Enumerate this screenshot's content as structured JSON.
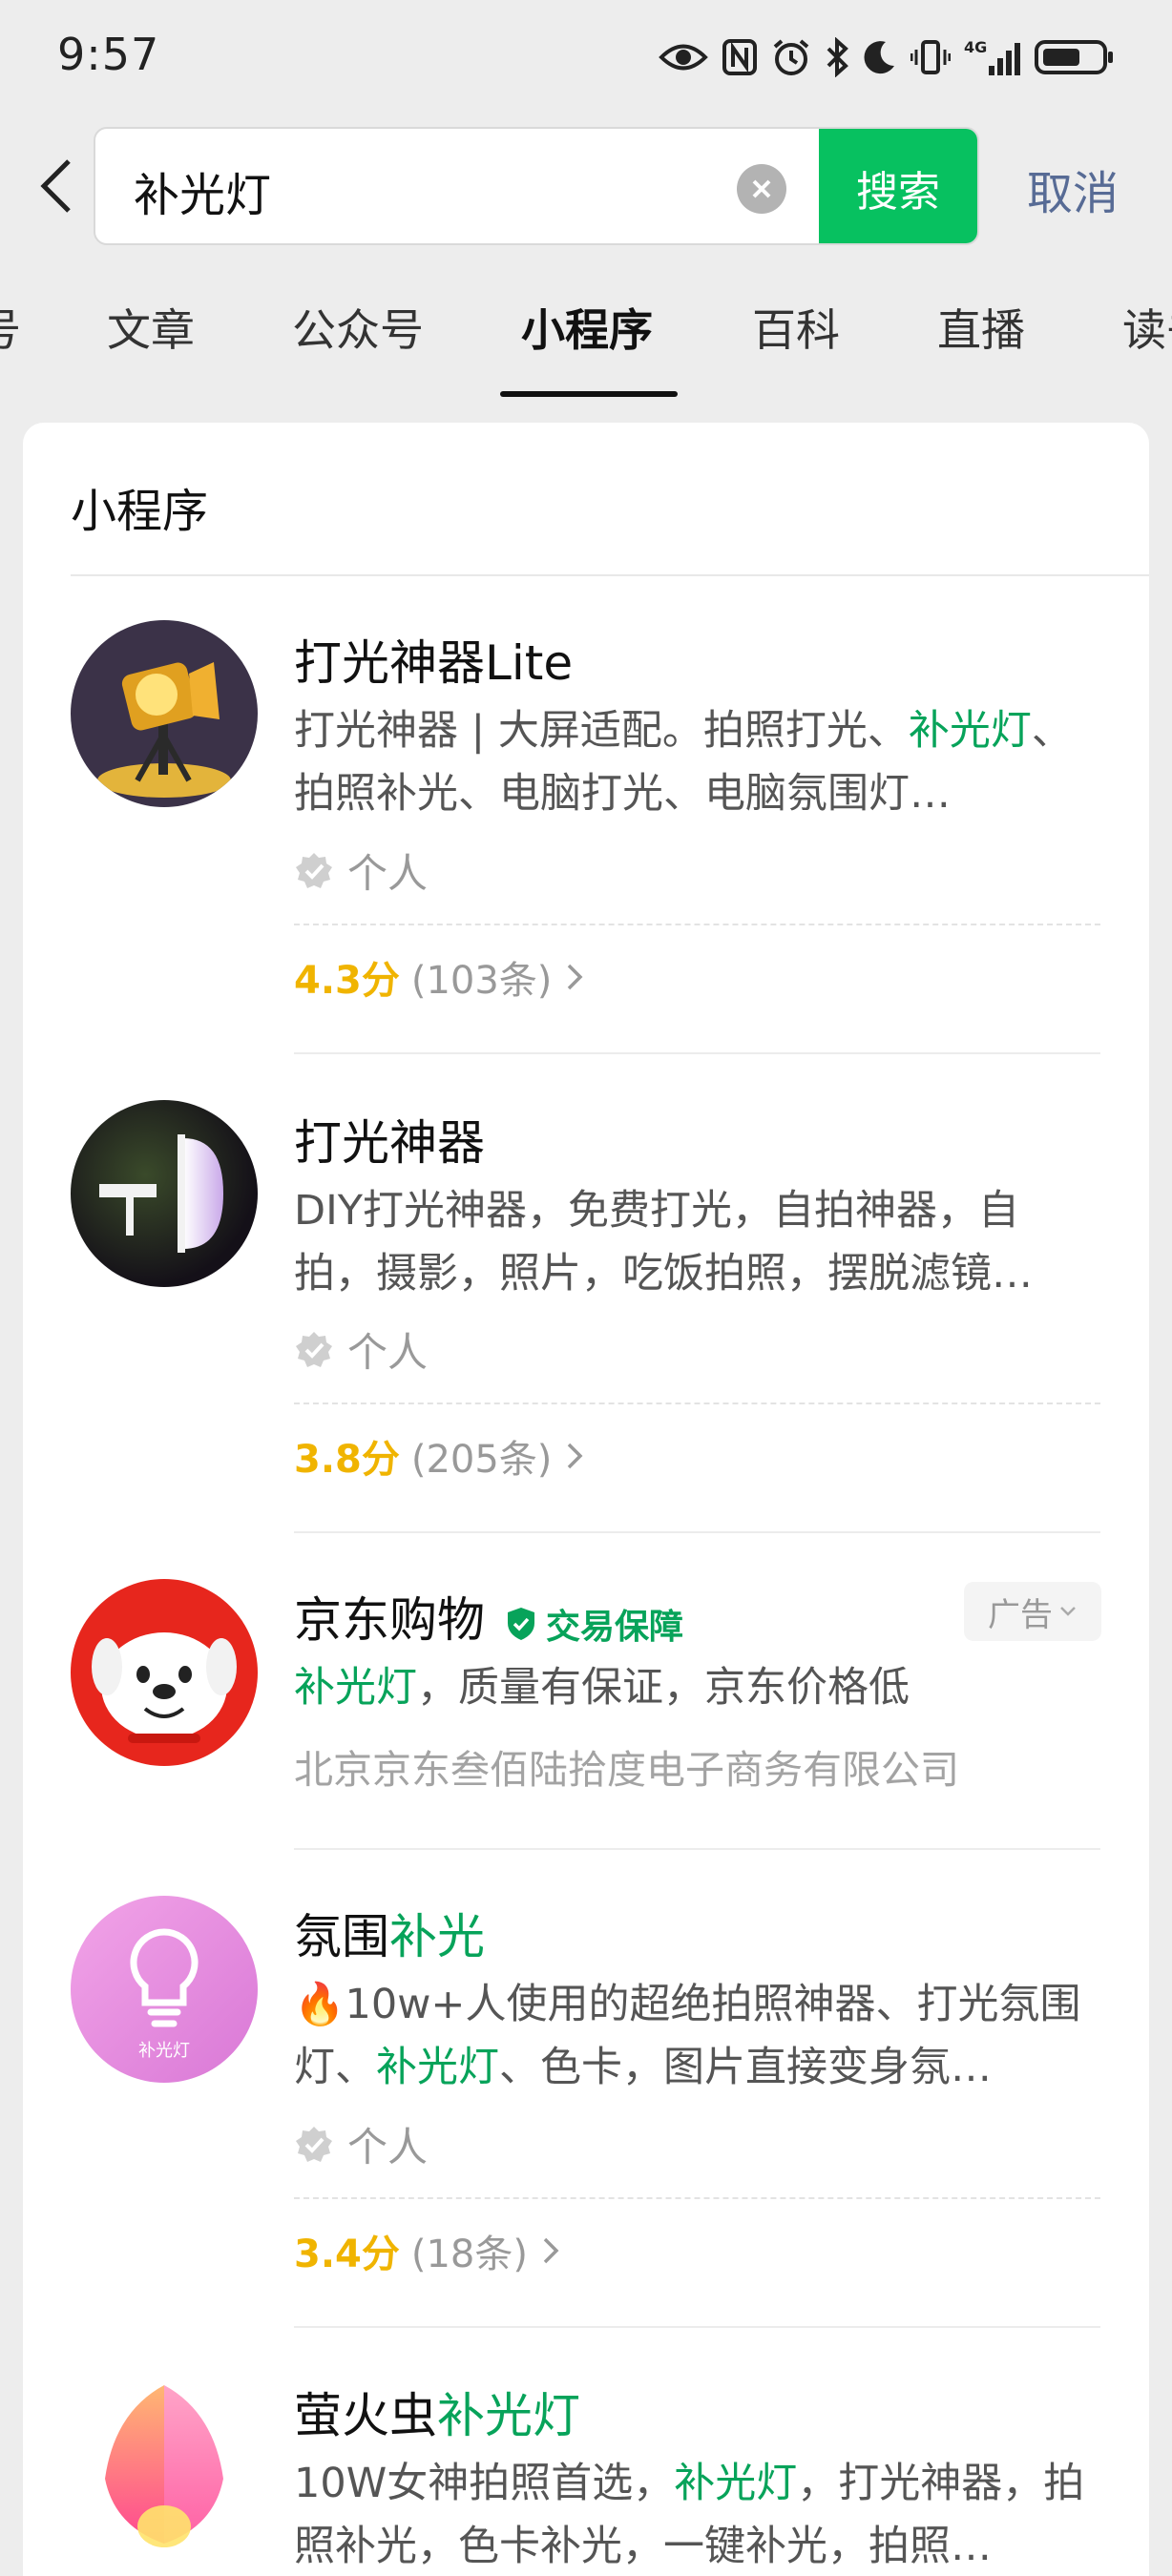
{
  "status_bar": {
    "time": "9:57"
  },
  "search": {
    "query": "补光灯",
    "button_label": "搜索",
    "cancel_label": "取消"
  },
  "tabs": [
    {
      "label": "号"
    },
    {
      "label": "文章"
    },
    {
      "label": "公众号"
    },
    {
      "label": "小程序"
    },
    {
      "label": "百科"
    },
    {
      "label": "直播"
    },
    {
      "label": "读书"
    }
  ],
  "section": {
    "title": "小程序"
  },
  "results": [
    {
      "name": "打光神器Lite",
      "desc_parts": [
        "打光神器 | 大屏适配。拍照打光、",
        "补光灯",
        "、拍照补光、电脑打光、电脑氛围灯…"
      ],
      "owner": "个人",
      "score": "4.3分",
      "count": "(103条)"
    },
    {
      "name": "打光神器",
      "desc": "DIY打光神器，免费打光，自拍神器，自拍，摄影，照片，吃饭拍照，摆脱滤镜…",
      "owner": "个人",
      "score": "3.8分",
      "count": "(205条)"
    },
    {
      "name": "京东购物",
      "badge": "交易保障",
      "ad_label": "广告",
      "desc_parts": [
        "补光灯",
        "，质量有保证，京东价格低"
      ],
      "company": "北京京东叁佰陆拾度电子商务有限公司"
    },
    {
      "name_parts": [
        "氛围",
        "补光"
      ],
      "desc_parts": [
        "🔥10w+人使用的超绝拍照神器、打光氛围灯、",
        "补光灯",
        "、色卡，图片直接变身氛…"
      ],
      "avatar_text": "补光灯",
      "owner": "个人",
      "score": "3.4分",
      "count": "(18条)"
    },
    {
      "name_parts": [
        "萤火虫",
        "补光灯"
      ],
      "desc_parts": [
        "10W女神拍照首选，",
        "补光灯",
        "，打光神器，拍照补光，色卡补光，一键补光，拍照…"
      ]
    }
  ],
  "colors": {
    "accent_green": "#07c160",
    "highlight": "#07a35a",
    "link_blue": "#576b95",
    "score_yellow": "#f0b400"
  }
}
